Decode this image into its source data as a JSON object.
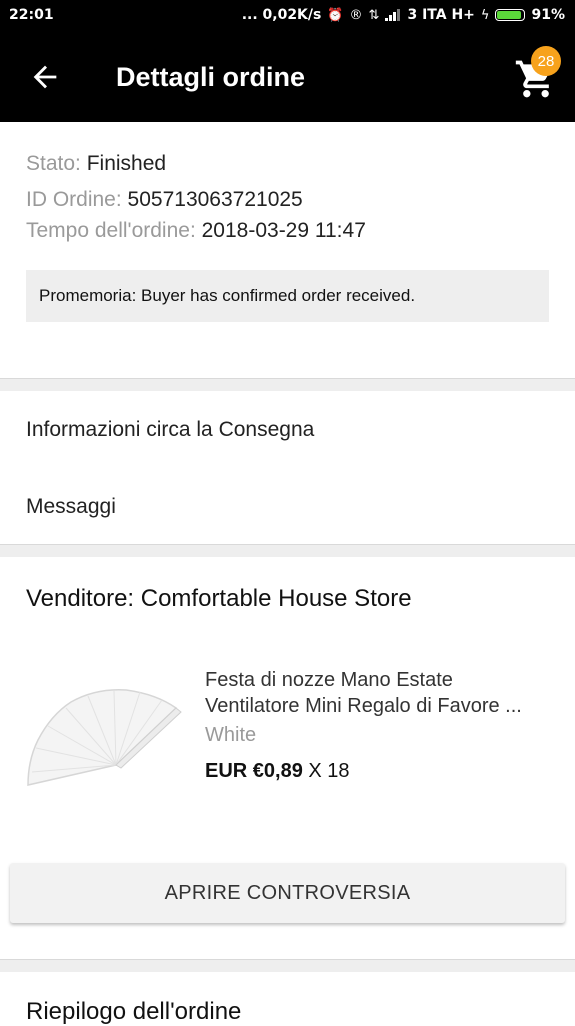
{
  "status_bar": {
    "time": "22:01",
    "net_speed": "... 0,02K/s",
    "carrier": "3 ITA H+",
    "battery": "91%",
    "battery_level": 0.91
  },
  "header": {
    "title": "Dettagli ordine",
    "cart_count": "28",
    "back_icon": "arrow-left-icon",
    "cart_icon": "shopping-cart-icon"
  },
  "order": {
    "status_label": "Stato:",
    "status_value": "Finished",
    "id_label": "ID Ordine:",
    "id_value": "505713063721025",
    "time_label": "Tempo dell'ordine:",
    "time_value": "2018-03-29 11:47",
    "memo": "Promemoria: Buyer has confirmed order received."
  },
  "links": {
    "delivery": "Informazioni circa la Consegna",
    "messages": "Messaggi"
  },
  "seller": {
    "label": "Venditore: Comfortable House Store"
  },
  "product": {
    "title_line1": "Festa di nozze Mano Estate",
    "title_line2": "Ventilatore Mini Regalo di Favore ...",
    "variant": "White",
    "price": "EUR €0,89",
    "quantity": "X 18"
  },
  "actions": {
    "dispute": "APRIRE CONTROVERSIA"
  },
  "summary": {
    "title": "Riepilogo dell'ordine"
  },
  "colors": {
    "header_bg": "#000000",
    "badge": "#f7a21c",
    "battery": "#5bd83a"
  }
}
